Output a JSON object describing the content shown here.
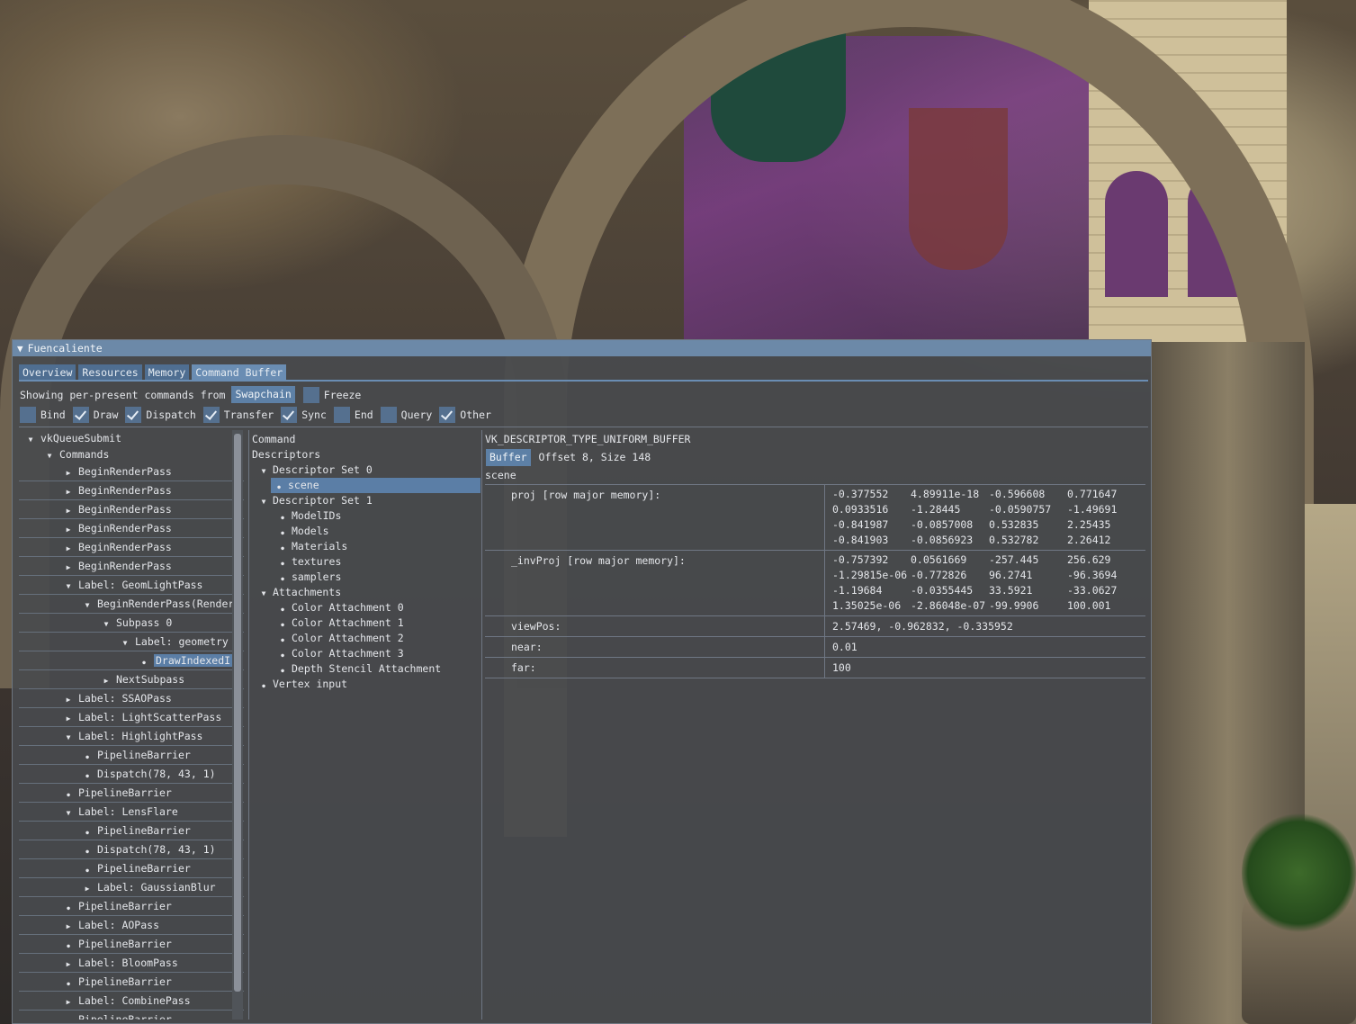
{
  "window": {
    "title": "Fuencaliente"
  },
  "tabs": [
    {
      "label": "Overview"
    },
    {
      "label": "Resources"
    },
    {
      "label": "Memory"
    },
    {
      "label": "Command Buffer"
    }
  ],
  "toolbar": {
    "showing_label": "Showing per-present commands from",
    "swapchain_button": "Swapchain",
    "freeze_label": "Freeze",
    "freeze_checked": false
  },
  "filters": [
    {
      "label": "Bind",
      "checked": false
    },
    {
      "label": "Draw",
      "checked": true
    },
    {
      "label": "Dispatch",
      "checked": true
    },
    {
      "label": "Transfer",
      "checked": true
    },
    {
      "label": "Sync",
      "checked": true
    },
    {
      "label": "End",
      "checked": false
    },
    {
      "label": "Query",
      "checked": false
    },
    {
      "label": "Other",
      "checked": true
    }
  ],
  "command_tree": [
    {
      "label": "vkQueueSubmit",
      "depth": 0,
      "kind": "open",
      "sep": false
    },
    {
      "label": "Commands",
      "depth": 1,
      "kind": "open",
      "sep": false
    },
    {
      "label": "BeginRenderPass",
      "depth": 2,
      "kind": "closed"
    },
    {
      "label": "BeginRenderPass",
      "depth": 2,
      "kind": "closed"
    },
    {
      "label": "BeginRenderPass",
      "depth": 2,
      "kind": "closed"
    },
    {
      "label": "BeginRenderPass",
      "depth": 2,
      "kind": "closed"
    },
    {
      "label": "BeginRenderPass",
      "depth": 2,
      "kind": "closed"
    },
    {
      "label": "BeginRenderPass",
      "depth": 2,
      "kind": "closed"
    },
    {
      "label": "Label: GeomLightPass",
      "depth": 2,
      "kind": "open"
    },
    {
      "label": "BeginRenderPass(Render",
      "depth": 3,
      "kind": "open"
    },
    {
      "label": "Subpass 0",
      "depth": 4,
      "kind": "open"
    },
    {
      "label": "Label: geometry",
      "depth": 5,
      "kind": "open"
    },
    {
      "label": "DrawIndexedIr",
      "depth": 6,
      "kind": "leaf",
      "selected": true
    },
    {
      "label": "NextSubpass",
      "depth": 4,
      "kind": "closed"
    },
    {
      "label": "Label: SSAOPass",
      "depth": 2,
      "kind": "closed"
    },
    {
      "label": "Label: LightScatterPass",
      "depth": 2,
      "kind": "closed"
    },
    {
      "label": "Label: HighlightPass",
      "depth": 2,
      "kind": "open"
    },
    {
      "label": "PipelineBarrier",
      "depth": 3,
      "kind": "leaf"
    },
    {
      "label": "Dispatch(78, 43, 1)",
      "depth": 3,
      "kind": "leaf"
    },
    {
      "label": "PipelineBarrier",
      "depth": 2,
      "kind": "leaf"
    },
    {
      "label": "Label: LensFlare",
      "depth": 2,
      "kind": "open"
    },
    {
      "label": "PipelineBarrier",
      "depth": 3,
      "kind": "leaf"
    },
    {
      "label": "Dispatch(78, 43, 1)",
      "depth": 3,
      "kind": "leaf"
    },
    {
      "label": "PipelineBarrier",
      "depth": 3,
      "kind": "leaf"
    },
    {
      "label": "Label: GaussianBlur",
      "depth": 3,
      "kind": "closed"
    },
    {
      "label": "PipelineBarrier",
      "depth": 2,
      "kind": "leaf"
    },
    {
      "label": "Label: AOPass",
      "depth": 2,
      "kind": "closed"
    },
    {
      "label": "PipelineBarrier",
      "depth": 2,
      "kind": "leaf"
    },
    {
      "label": "Label: BloomPass",
      "depth": 2,
      "kind": "closed"
    },
    {
      "label": "PipelineBarrier",
      "depth": 2,
      "kind": "leaf"
    },
    {
      "label": "Label: CombinePass",
      "depth": 2,
      "kind": "closed"
    },
    {
      "label": "PipelineBarrier",
      "depth": 2,
      "kind": "leaf"
    }
  ],
  "inspector": [
    {
      "label": "Command",
      "depth": 0,
      "kind": "text"
    },
    {
      "label": "Descriptors",
      "depth": 0,
      "kind": "text"
    },
    {
      "label": "Descriptor Set 0",
      "depth": 0,
      "kind": "open"
    },
    {
      "label": "scene",
      "depth": 1,
      "kind": "leaf",
      "selected": true
    },
    {
      "label": "Descriptor Set 1",
      "depth": 0,
      "kind": "open"
    },
    {
      "label": "ModelIDs",
      "depth": 1,
      "kind": "leaf"
    },
    {
      "label": "Models",
      "depth": 1,
      "kind": "leaf"
    },
    {
      "label": "Materials",
      "depth": 1,
      "kind": "leaf"
    },
    {
      "label": "textures",
      "depth": 1,
      "kind": "leaf"
    },
    {
      "label": "samplers",
      "depth": 1,
      "kind": "leaf"
    },
    {
      "label": "Attachments",
      "depth": 0,
      "kind": "open"
    },
    {
      "label": "Color Attachment 0",
      "depth": 1,
      "kind": "leaf"
    },
    {
      "label": "Color Attachment 1",
      "depth": 1,
      "kind": "leaf"
    },
    {
      "label": "Color Attachment 2",
      "depth": 1,
      "kind": "leaf"
    },
    {
      "label": "Color Attachment 3",
      "depth": 1,
      "kind": "leaf"
    },
    {
      "label": "Depth Stencil Attachment",
      "depth": 1,
      "kind": "leaf"
    },
    {
      "label": "Vertex input",
      "depth": 0,
      "kind": "leaf"
    }
  ],
  "descriptor": {
    "type": "VK_DESCRIPTOR_TYPE_UNIFORM_BUFFER",
    "buffer_button": "Buffer",
    "buffer_info": "Offset 8, Size 148",
    "name": "scene",
    "fields": [
      {
        "name": "proj [row major memory]:",
        "matrix": [
          [
            "-0.377552",
            "4.89911e-18",
            "-0.596608",
            "0.771647"
          ],
          [
            "0.0933516",
            "-1.28445",
            "-0.0590757",
            "-1.49691"
          ],
          [
            "-0.841987",
            "-0.0857008",
            "0.532835",
            "2.25435"
          ],
          [
            "-0.841903",
            "-0.0856923",
            "0.532782",
            "2.26412"
          ]
        ]
      },
      {
        "name": "_invProj [row major memory]:",
        "matrix": [
          [
            "-0.757392",
            "0.0561669",
            "-257.445",
            "256.629"
          ],
          [
            "-1.29815e-06",
            "-0.772826",
            "96.2741",
            "-96.3694"
          ],
          [
            "-1.19684",
            "-0.0355445",
            "33.5921",
            "-33.0627"
          ],
          [
            "1.35025e-06",
            "-2.86048e-07",
            "-99.9906",
            "100.001"
          ]
        ]
      },
      {
        "name": "viewPos:",
        "value": "2.57469, -0.962832, -0.335952"
      },
      {
        "name": "near:",
        "value": "0.01"
      },
      {
        "name": "far:",
        "value": "100"
      }
    ]
  }
}
